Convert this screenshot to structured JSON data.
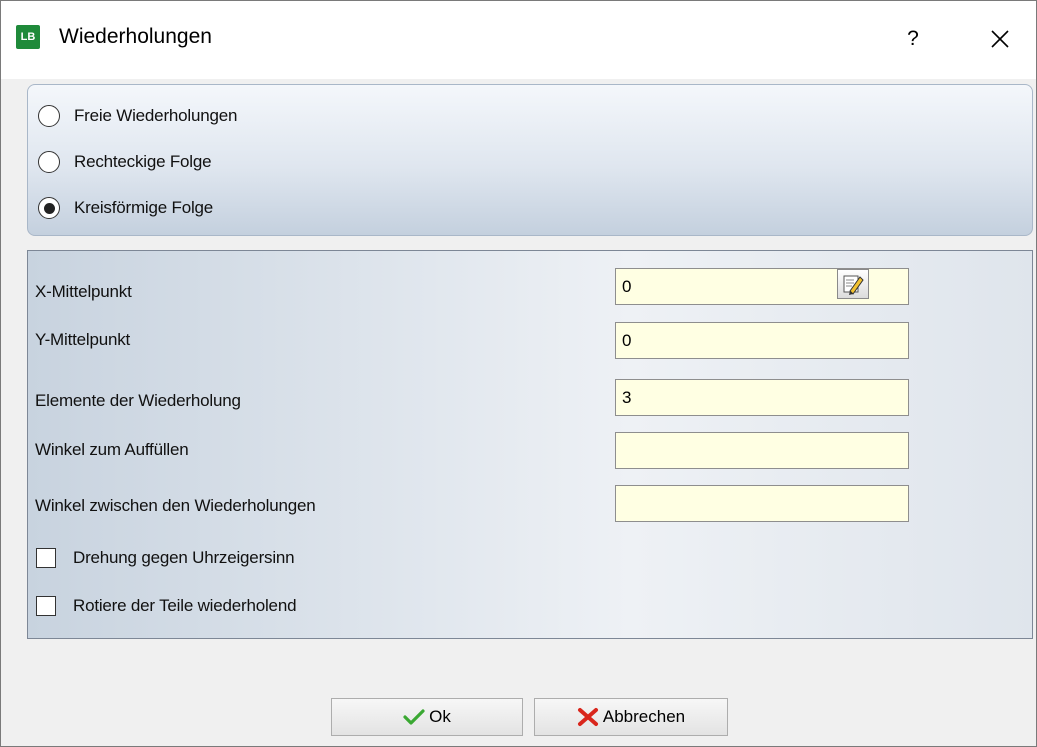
{
  "window": {
    "title": "Wiederholungen",
    "app_icon_text": "LB",
    "help_label": "?"
  },
  "mode_options": [
    {
      "label": "Freie Wiederholungen",
      "selected": false
    },
    {
      "label": "Rechteckige Folge",
      "selected": false
    },
    {
      "label": "Kreisförmige Folge",
      "selected": true
    }
  ],
  "fields": {
    "x_center": {
      "label": "X-Mittelpunkt",
      "value": "0"
    },
    "y_center": {
      "label": "Y-Mittelpunkt",
      "value": "0"
    },
    "elements": {
      "label": "Elemente der Wiederholung",
      "value": "3"
    },
    "fill_angle": {
      "label": "Winkel zum Auffüllen",
      "value": ""
    },
    "step_angle": {
      "label": "Winkel zwischen den Wiederholungen",
      "value": ""
    }
  },
  "checkboxes": [
    {
      "label": "Drehung gegen Uhrzeigersinn",
      "checked": false
    },
    {
      "label": "Rotiere der Teile wiederholend",
      "checked": false
    }
  ],
  "buttons": {
    "ok_label": "Ok",
    "cancel_label": "Abbrechen"
  },
  "colors": {
    "input_background": "#ffffe3",
    "ok_check": "#3aa832",
    "cancel_x": "#d9261c",
    "app_icon": "#1f8a3a"
  },
  "icons": {
    "app": "application-logo-icon",
    "close": "close-icon",
    "edit": "edit-pencil-icon",
    "ok": "check-icon",
    "cancel": "x-mark-icon"
  }
}
